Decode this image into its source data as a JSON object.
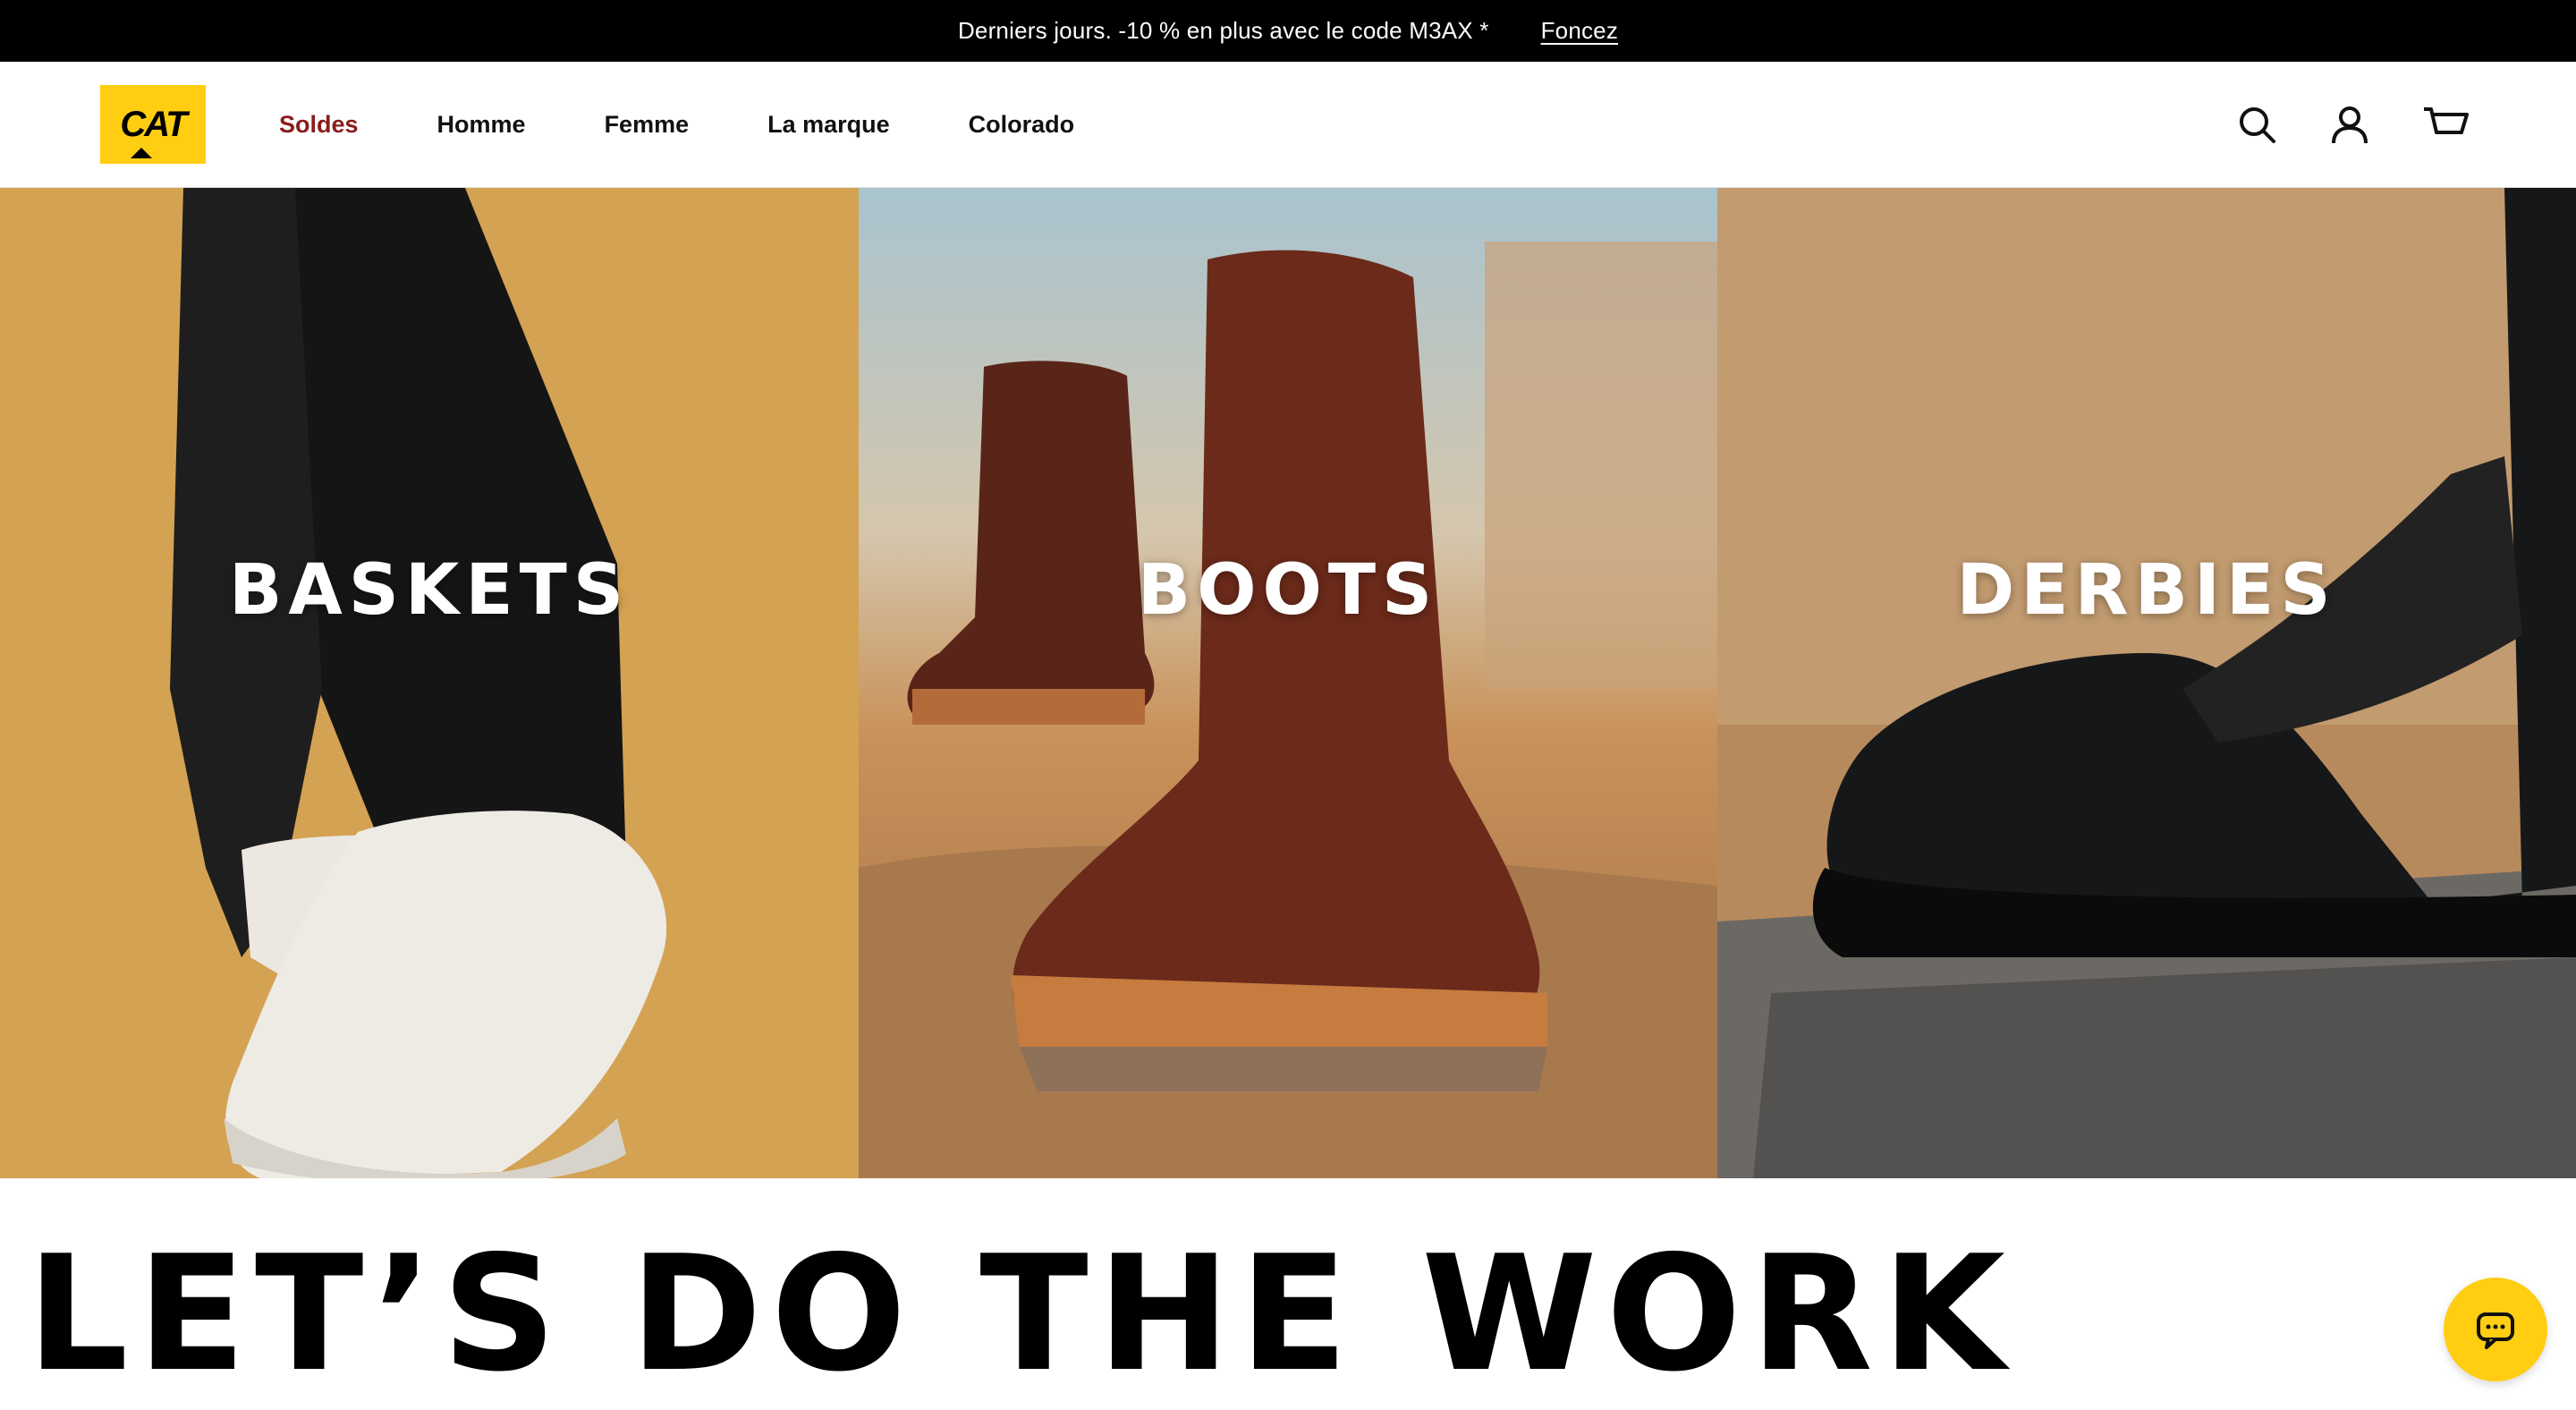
{
  "promo": {
    "message": "Derniers jours. -10 % en plus avec le code M3AX *",
    "link": "Foncez"
  },
  "header": {
    "logo_text": "CAT",
    "nav": [
      {
        "label": "Soldes",
        "highlight": "#8a1d1d"
      },
      {
        "label": "Homme"
      },
      {
        "label": "Femme"
      },
      {
        "label": "La marque"
      },
      {
        "label": "Colorado"
      }
    ],
    "icons": [
      "search-icon",
      "account-icon",
      "cart-icon"
    ]
  },
  "hero": {
    "tiles": [
      {
        "label": "BASKETS"
      },
      {
        "label": "BOOTS"
      },
      {
        "label": "DERBIES"
      }
    ]
  },
  "tagline": "LET’S DO THE WORK",
  "chat": {
    "icon": "chat-icon"
  },
  "colors": {
    "brand_yellow": "#ffcd11",
    "sale_red": "#8a1d1d"
  }
}
